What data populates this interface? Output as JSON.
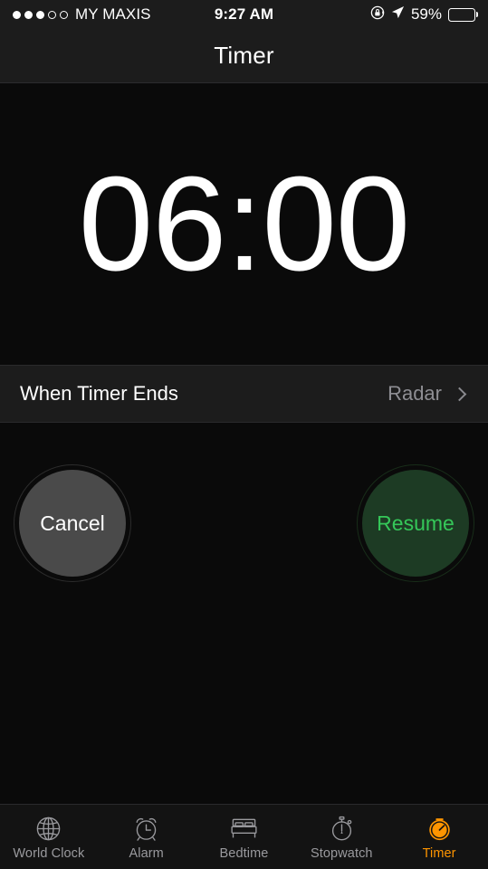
{
  "status_bar": {
    "carrier": "MY MAXIS",
    "signal_dots_filled": 3,
    "signal_dots_total": 5,
    "time": "9:27 AM",
    "battery_percent": "59%",
    "battery_level": 59,
    "rotation_lock_icon": "rotation-lock-icon",
    "location_icon": "location-arrow-icon"
  },
  "nav": {
    "title": "Timer"
  },
  "timer": {
    "value": "06:00",
    "minutes": "06",
    "seconds": "00"
  },
  "settings_row": {
    "label": "When Timer Ends",
    "value": "Radar",
    "chevron_icon": "chevron-right-icon"
  },
  "controls": {
    "cancel_label": "Cancel",
    "resume_label": "Resume",
    "cancel_color": "#4a4a4a",
    "resume_color": "#1d3b24",
    "resume_text_color": "#35c759"
  },
  "tab_bar": {
    "active_color": "#ff9500",
    "inactive_color": "#9a9a9e",
    "tabs": [
      {
        "label": "World Clock",
        "icon": "globe-icon",
        "active": false
      },
      {
        "label": "Alarm",
        "icon": "alarm-clock-icon",
        "active": false
      },
      {
        "label": "Bedtime",
        "icon": "bed-icon",
        "active": false
      },
      {
        "label": "Stopwatch",
        "icon": "stopwatch-icon",
        "active": false
      },
      {
        "label": "Timer",
        "icon": "timer-icon",
        "active": true
      }
    ]
  }
}
